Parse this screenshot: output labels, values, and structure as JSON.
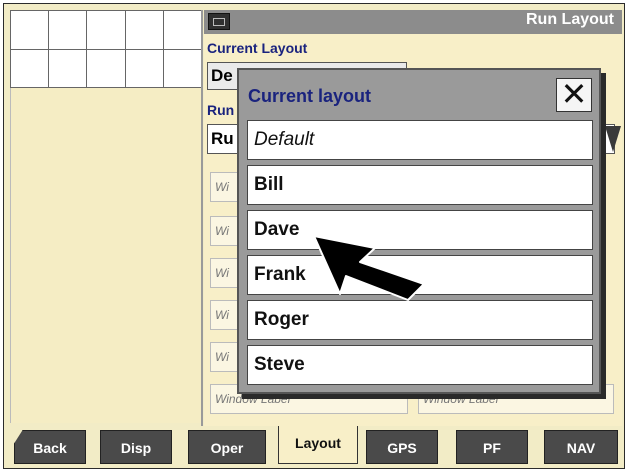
{
  "window": {
    "title": "Run Layout",
    "camera_icon": "camera-icon"
  },
  "current_layout": {
    "label": "Current Layout",
    "value": "De"
  },
  "run": {
    "label": "Run",
    "value": "Ru"
  },
  "window_labels": [
    "Wi",
    "Wi",
    "Wi",
    "Wi",
    "Wi",
    "Window Label",
    "Window Label"
  ],
  "popup": {
    "title": "Current layout",
    "close_icon": "close-icon",
    "options": [
      "Default",
      "Bill",
      "Dave",
      "Frank",
      "Roger",
      "Steve"
    ]
  },
  "nav": {
    "tabs": [
      "Back",
      "Disp",
      "Oper",
      "Layout",
      "GPS",
      "PF",
      "NAV"
    ],
    "active": "Layout"
  }
}
